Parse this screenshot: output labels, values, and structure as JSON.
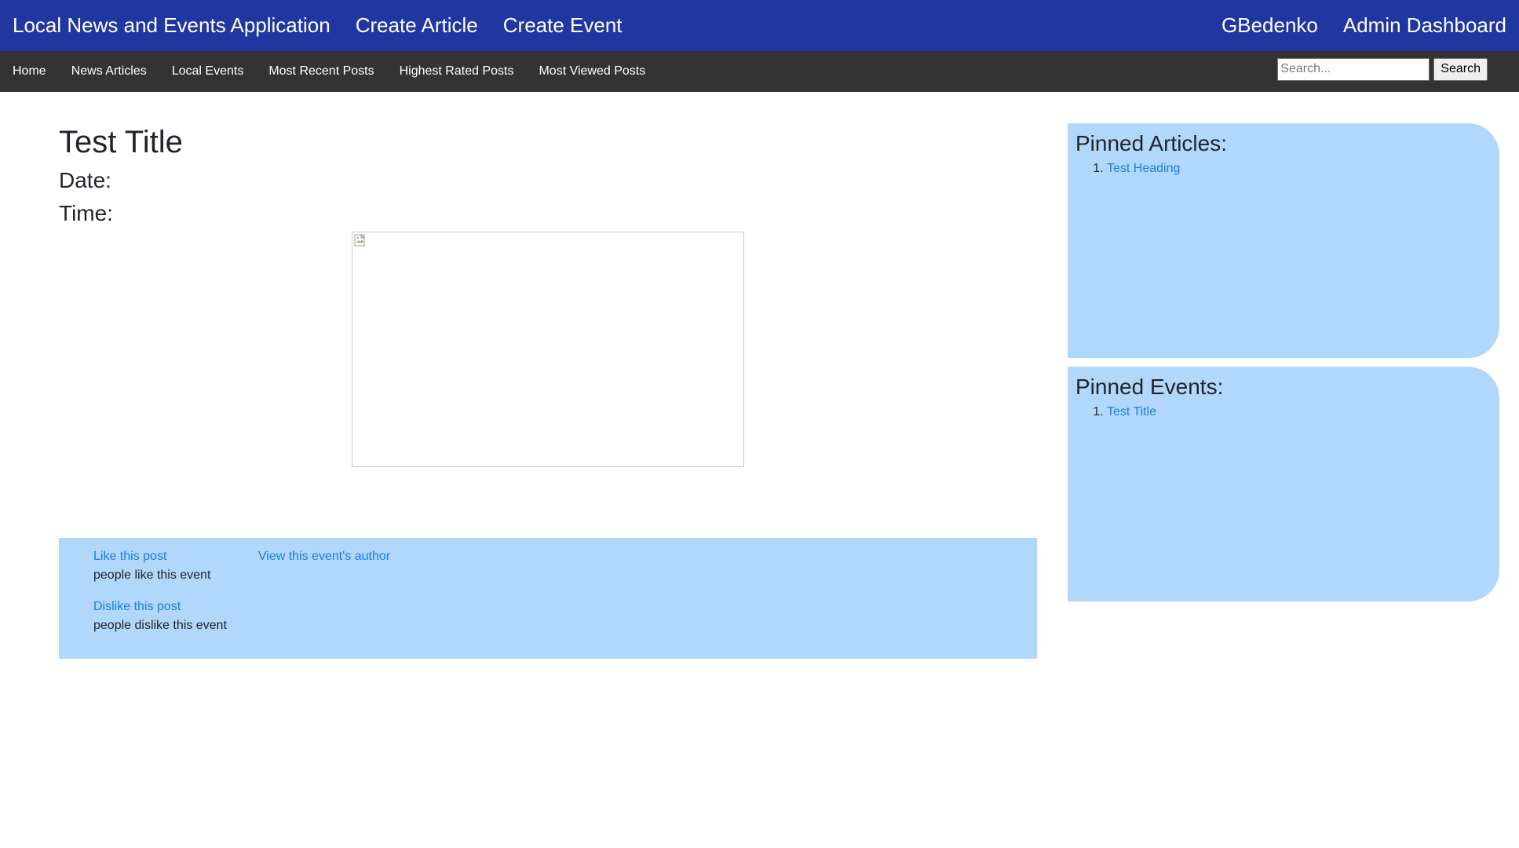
{
  "topbar": {
    "app_title": "Local News and Events Application",
    "create_article": "Create Article",
    "create_event": "Create Event",
    "username": "GBedenko",
    "admin_dashboard": "Admin Dashboard",
    "background_color": "#2036a0"
  },
  "subnav": {
    "items": [
      {
        "label": "Home"
      },
      {
        "label": "News Articles"
      },
      {
        "label": "Local Events"
      },
      {
        "label": "Most Recent Posts"
      },
      {
        "label": "Highest Rated Posts"
      },
      {
        "label": "Most Viewed Posts"
      }
    ],
    "search_placeholder": "Search...",
    "search_value": "",
    "search_button": "Search",
    "background_color": "#333333"
  },
  "event": {
    "title": "Test Title",
    "date_label": "Date:",
    "time_label": "Time:",
    "image_icon": "broken-image-icon"
  },
  "actions": {
    "like_link": "Like this post",
    "like_count_text": "people like this event",
    "dislike_link": "Dislike this post",
    "dislike_count_text": "people dislike this event",
    "author_link": "View this event's author",
    "background_color": "#b1d7fb"
  },
  "sidebar": {
    "pinned_articles": {
      "heading": "Pinned Articles:",
      "items": [
        {
          "label": "Test Heading"
        }
      ]
    },
    "pinned_events": {
      "heading": "Pinned Events:",
      "items": [
        {
          "label": "Test Title"
        }
      ]
    },
    "link_color": "#1a7ee6"
  }
}
